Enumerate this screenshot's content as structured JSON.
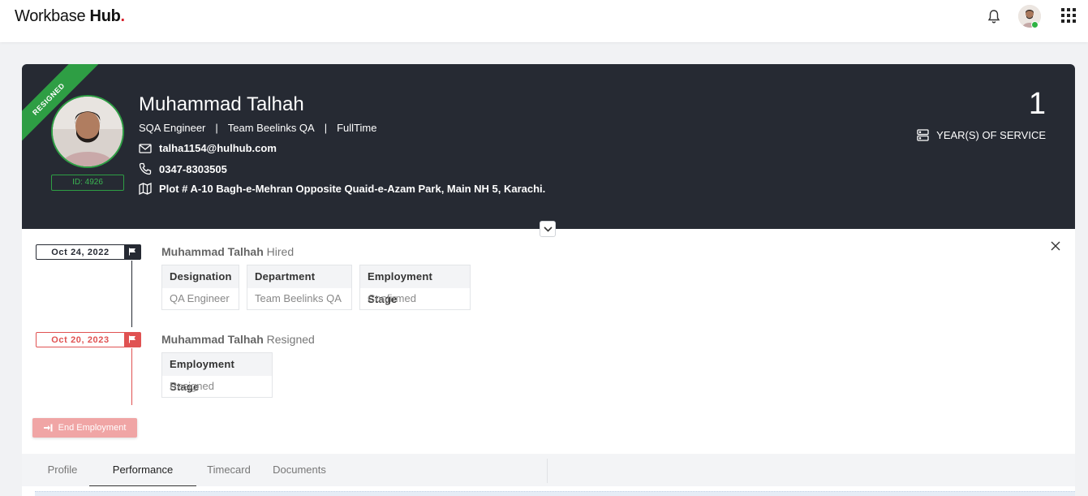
{
  "app": {
    "logo_text": "Workbase",
    "logo_bold": "Hub",
    "logo_dot": "."
  },
  "header_icons": [
    "bell-icon",
    "avatar",
    "apps-grid-icon"
  ],
  "profile": {
    "status_ribbon": "RESIGNED",
    "name": "Muhammad Talhah",
    "title": "SQA Engineer",
    "separator": "|",
    "team": "Team Beelinks QA",
    "employment_type": "FullTime",
    "email": "talha1154@hulhub.com",
    "phone": "0347-8303505",
    "address": "Plot # A-10 Bagh-e-Mehran Opposite Quaid-e-Azam Park, Main NH 5, Karachi.",
    "id_label": "ID: 4926",
    "years_of_service": "1",
    "years_label": "YEAR(S) OF SERVICE"
  },
  "colors": {
    "hero_bg": "#262a33",
    "resigned_green": "#2e9e44",
    "resigned_red": "#e05252",
    "end_button": "#f0a5a5"
  },
  "timeline": {
    "events": [
      {
        "date": "Oct 24, 2022",
        "person": "Muhammad Talhah",
        "action": "Hired",
        "fields": [
          {
            "label": "Designation",
            "value": "QA Engineer"
          },
          {
            "label": "Department",
            "value": "Team Beelinks QA"
          },
          {
            "label": "Employment Stage",
            "value": "Confirmed"
          }
        ]
      },
      {
        "date": "Oct 20, 2023",
        "person": "Muhammad Talhah",
        "action": "Resigned",
        "fields": [
          {
            "label": "Employment Stage",
            "value": "Resigned"
          }
        ]
      }
    ],
    "end_button_label": "End Employment"
  },
  "tabs": [
    {
      "label": "Profile",
      "active": false
    },
    {
      "label": "Performance",
      "active": true
    },
    {
      "label": "Timecard",
      "active": false
    },
    {
      "label": "Documents",
      "active": false
    }
  ]
}
